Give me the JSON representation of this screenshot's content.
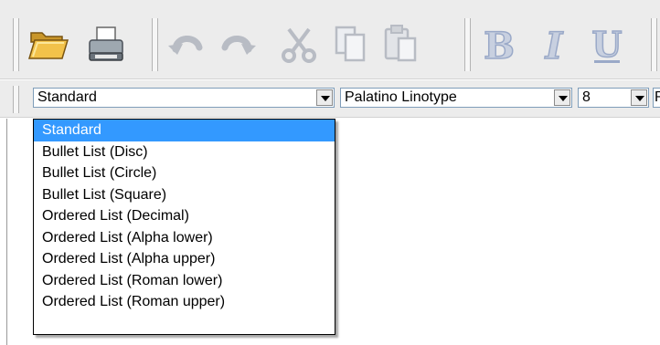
{
  "toolbar": {
    "icons": [
      "open-folder-icon",
      "print-icon",
      "undo-icon",
      "redo-icon",
      "cut-icon",
      "copy-icon",
      "paste-icon",
      "bold-icon",
      "italic-icon",
      "underline-icon"
    ],
    "bold_label": "B",
    "italic_label": "I",
    "underline_label": "U"
  },
  "format_bar": {
    "style_value": "Standard",
    "font_value": "Palatino Linotype",
    "size_value": "8",
    "extra_value": "R"
  },
  "style_dropdown": {
    "selected": "Standard",
    "options": [
      "Standard",
      "Bullet List (Disc)",
      "Bullet List (Circle)",
      "Bullet List (Square)",
      "Ordered List (Decimal)",
      "Ordered List (Alpha lower)",
      "Ordered List (Alpha upper)",
      "Ordered List (Roman lower)",
      "Ordered List (Roman upper)"
    ]
  },
  "colors": {
    "toolbar_bg": "#ececec",
    "selection_bg": "#3399ff",
    "format_letters": "#9aa9c8"
  }
}
